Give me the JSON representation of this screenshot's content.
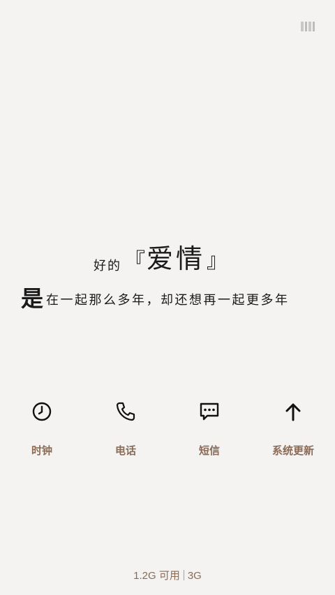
{
  "quote": {
    "line1_prefix": "好的",
    "bracket_open": "『",
    "line1_highlight": "爱情",
    "bracket_close": "』",
    "line2_lead": "是",
    "line2_rest": "在一起那么多年，却还想再一起更多年"
  },
  "shortcuts": [
    {
      "label": "时钟",
      "icon": "clock-icon"
    },
    {
      "label": "电话",
      "icon": "phone-icon"
    },
    {
      "label": "短信",
      "icon": "message-icon"
    },
    {
      "label": "系统更新",
      "icon": "arrow-up-icon"
    }
  ],
  "memory": {
    "available": "1.2G 可用",
    "total": "3G"
  },
  "colors": {
    "background": "#f4f3f2",
    "label": "#8b6b56",
    "text": "#1a1a1a"
  }
}
